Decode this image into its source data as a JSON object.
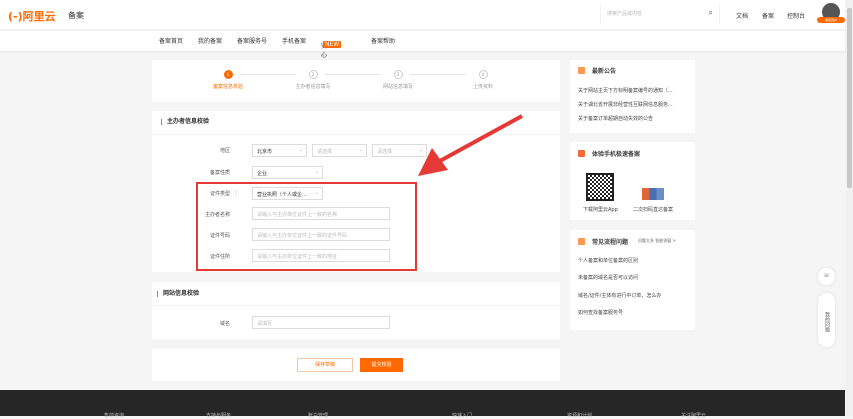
{
  "header": {
    "logo": "(-)阿里云",
    "product": "备案",
    "search_placeholder": "搜索产品或内容",
    "links": [
      "文档",
      "备案",
      "控制台"
    ],
    "avatar_badge": "备案待办"
  },
  "nav": {
    "items": [
      "备案首页",
      "我的备案",
      "备案服务号",
      "手机备案",
      "安心备",
      "备案帮助"
    ],
    "new_badge": "NEW"
  },
  "steps": [
    {
      "num": "1",
      "label": "备案信息校验",
      "active": true
    },
    {
      "num": "2",
      "label": "主办者信息填写"
    },
    {
      "num": "3",
      "label": "网站信息填写"
    },
    {
      "num": "4",
      "label": "上传资料"
    }
  ],
  "sponsor": {
    "title": "主办者信息校验",
    "region_label": "地区",
    "region": [
      "北京市",
      "请选择",
      "请选择"
    ],
    "nature_label": "备案性质",
    "nature": "企业",
    "cert_type_label": "证件类型",
    "cert_type": "营业执照（个人或企...",
    "name_label": "主办者名称",
    "name_placeholder": "请输入与主办单位证件上一致的名称",
    "cert_no_label": "证件号码",
    "cert_no_placeholder": "请输入与主办单位证件上一致的证件号码",
    "address_label": "证件住所",
    "address_placeholder": "请输入与主办单位证件上一致的地址"
  },
  "site": {
    "title": "网站信息校验",
    "domain_label": "域名",
    "domain_placeholder": "请填写"
  },
  "actions": {
    "save": "保存草稿",
    "submit": "提交校验"
  },
  "sidebar": {
    "notice_title": "最新公告",
    "notices": [
      "关于网站主页下方标明备案编号的通知（...",
      "关于湖北省开展非经营性互联网信息服务...",
      "关于备案订单超期自动失效的公告"
    ],
    "mobile_title": "体验手机极速备案",
    "qr_labels": [
      "下载阿里云App",
      "二次扫码直达备案"
    ],
    "faq_title": "常见流程问题",
    "faq_more": "问题太多 智能答疑 >",
    "faqs": [
      "个人备案和单位备案的区别",
      "未备案的域名是否可以访问",
      "域名/证件/主体有进行中订单，怎么办",
      "如何查找备案服务号"
    ]
  },
  "float": {
    "my_questions": "我的问题"
  },
  "footer": {
    "cols": [
      "售前咨询",
      "支持与服务",
      "账户管理",
      "快速入门",
      "资源和计划",
      "关注阿里云"
    ]
  },
  "colors": {
    "accent": "#ff6a00",
    "highlight": "#e53935"
  }
}
